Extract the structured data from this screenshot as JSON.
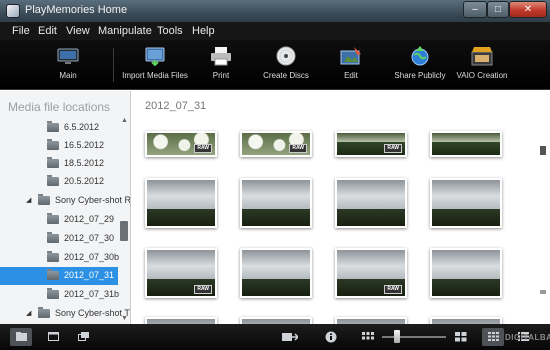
{
  "window": {
    "title": "PlayMemories Home"
  },
  "menubar": {
    "items": [
      "File",
      "Edit",
      "View",
      "Manipulate",
      "Tools",
      "Help"
    ]
  },
  "toolbar": {
    "items": [
      {
        "label": "Main",
        "icon": "main-icon"
      },
      {
        "label": "Import Media Files",
        "icon": "import-media-icon"
      },
      {
        "label": "Print",
        "icon": "print-icon"
      },
      {
        "label": "Create Discs",
        "icon": "disc-icon"
      },
      {
        "label": "Edit",
        "icon": "edit-icon"
      },
      {
        "label": "Share Publicly",
        "icon": "share-icon"
      },
      {
        "label": "VAIO Creation",
        "icon": "vaio-creation-icon"
      }
    ]
  },
  "sidebar": {
    "title": "Media file locations",
    "tree": [
      {
        "label": "6.5.2012",
        "type": "folder",
        "selected": false
      },
      {
        "label": "16.5.2012",
        "type": "folder",
        "selected": false
      },
      {
        "label": "18.5.2012",
        "type": "folder",
        "selected": false
      },
      {
        "label": "20.5.2012",
        "type": "folder",
        "selected": false
      },
      {
        "label": "Sony Cyber-shot RX:",
        "type": "device",
        "selected": false
      },
      {
        "label": "2012_07_29",
        "type": "folder",
        "selected": false
      },
      {
        "label": "2012_07_30",
        "type": "folder",
        "selected": false
      },
      {
        "label": "2012_07_30b",
        "type": "folder",
        "selected": false
      },
      {
        "label": "2012_07_31",
        "type": "folder",
        "selected": true
      },
      {
        "label": "2012_07_31b",
        "type": "folder",
        "selected": false
      },
      {
        "label": "Sony Cyber-shot TX",
        "type": "device",
        "selected": false
      }
    ]
  },
  "main": {
    "date_header": "2012_07_31",
    "raw_label": "RAW"
  },
  "statusbar": {
    "watermark": "DIGITALBASE"
  },
  "colors": {
    "selection": "#2c91e5",
    "toolbar_bg": "#000000",
    "menubar_bg": "#161616"
  }
}
